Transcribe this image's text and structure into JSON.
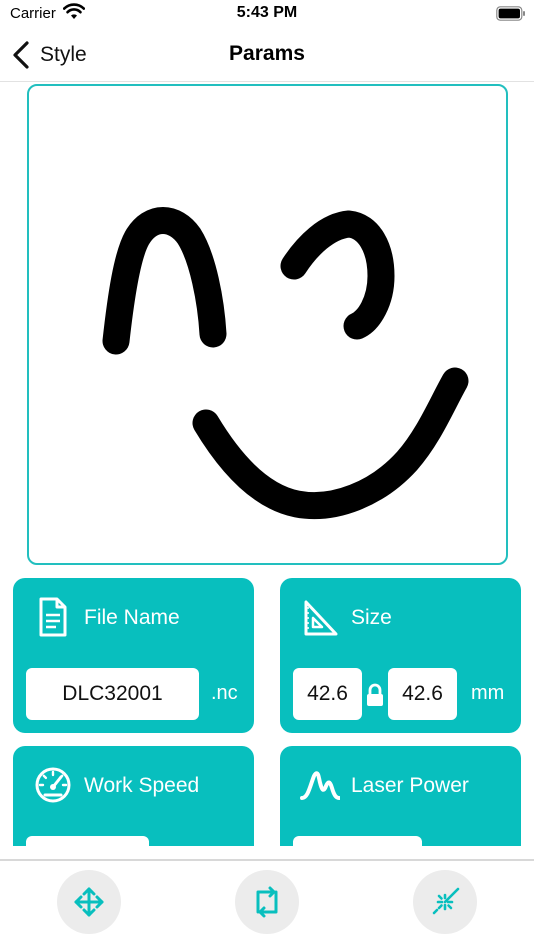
{
  "status": {
    "carrier": "Carrier",
    "time": "5:43 PM"
  },
  "nav": {
    "back_label": "Style",
    "title": "Params"
  },
  "cards": {
    "file_name": {
      "title": "File Name",
      "value": "DLC32001",
      "extension": ".nc"
    },
    "size": {
      "title": "Size",
      "width": "42.6",
      "height": "42.6",
      "unit": "mm"
    },
    "work_speed": {
      "title": "Work Speed"
    },
    "laser_power": {
      "title": "Laser Power"
    }
  },
  "toolbar": {
    "move_icon": "move-arrows-icon",
    "transform_icon": "transform-icon",
    "laser_icon": "laser-icon"
  },
  "colors": {
    "accent": "#08bfbe",
    "canvas_border": "#22bfbf",
    "tool_bg": "#ececec"
  }
}
